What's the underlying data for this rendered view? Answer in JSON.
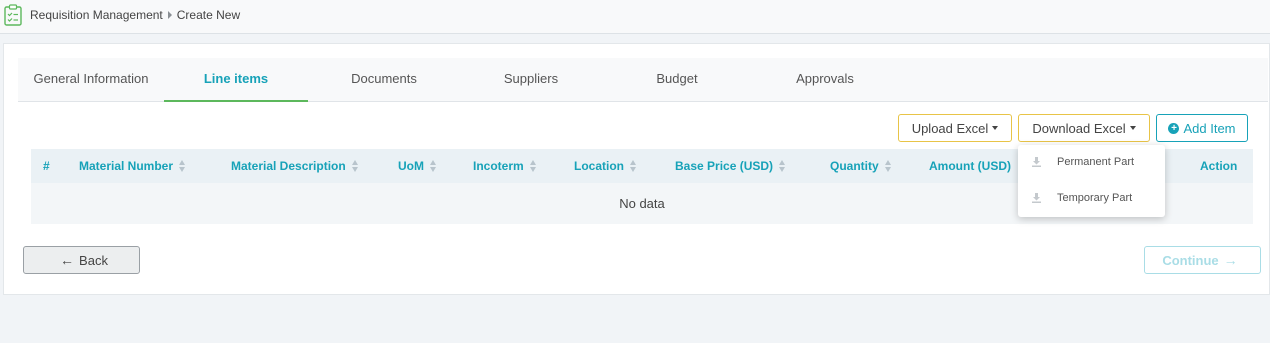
{
  "breadcrumb": {
    "root": "Requisition Management",
    "current": "Create New"
  },
  "tabs": [
    {
      "label": "General Information"
    },
    {
      "label": "Line items"
    },
    {
      "label": "Documents"
    },
    {
      "label": "Suppliers"
    },
    {
      "label": "Budget"
    },
    {
      "label": "Approvals"
    }
  ],
  "active_tab": "Line items",
  "toolbar": {
    "upload_label": "Upload Excel",
    "download_label": "Download Excel",
    "add_label": "Add Item"
  },
  "download_menu": [
    {
      "label": "Permanent Part"
    },
    {
      "label": "Temporary Part"
    }
  ],
  "table": {
    "columns": [
      {
        "label": "#"
      },
      {
        "label": "Material Number"
      },
      {
        "label": "Material Description"
      },
      {
        "label": "UoM"
      },
      {
        "label": "Incoterm"
      },
      {
        "label": "Location"
      },
      {
        "label": "Base Price (USD)"
      },
      {
        "label": "Quantity"
      },
      {
        "label": "Amount (USD)"
      },
      {
        "label": "Action"
      }
    ],
    "empty_text": "No data"
  },
  "footer": {
    "back_label": "Back",
    "continue_label": "Continue"
  },
  "colors": {
    "accent": "#17a2b8",
    "tab_underline": "#5cb85c",
    "excel_border": "#e8c447"
  }
}
